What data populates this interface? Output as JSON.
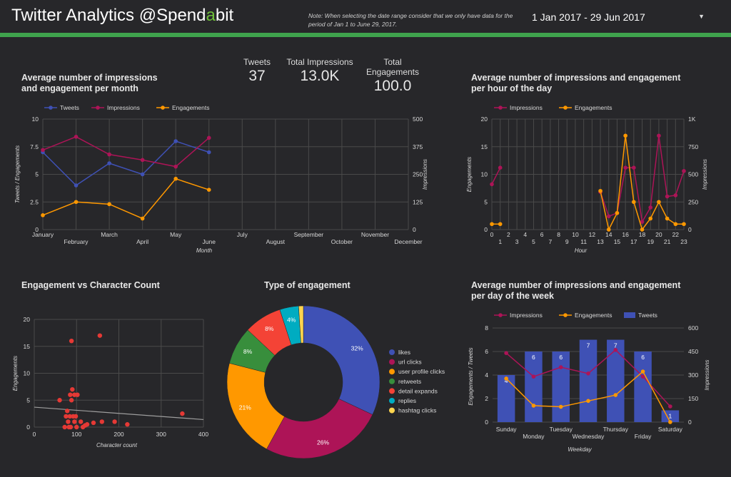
{
  "header": {
    "title_prefix": "Twitter Analytics @Spend",
    "title_highlight": "a",
    "title_suffix": "bit",
    "note": "Note: When selecting the date range consider that we only have data for the period of Jan 1 to June 29, 2017.",
    "date_range": "1 Jan 2017 - 29 Jun 2017",
    "dropdown_icon": "triangle-down",
    "accent_color": "#3fa34d"
  },
  "kpis": [
    {
      "label": "Tweets",
      "value": "37"
    },
    {
      "label": "Total Impressions",
      "value": "13.0K"
    },
    {
      "label": "Total Engagements",
      "value": "100.0"
    }
  ],
  "colors": {
    "tweets": "#3f51b5",
    "impressions": "#ad1457",
    "engagements": "#ff9800",
    "grid": "#4a4a4a",
    "axis_text": "#d8d8d8"
  },
  "chart_data": [
    {
      "id": "monthly",
      "type": "line",
      "title": "Average number of impressions and engagement per month",
      "x": [
        "January",
        "February",
        "March",
        "April",
        "May",
        "June",
        "July",
        "August",
        "September",
        "October",
        "November",
        "December"
      ],
      "series": [
        {
          "name": "Tweets",
          "axis": "left",
          "values": [
            7,
            4,
            6,
            5,
            8,
            7
          ]
        },
        {
          "name": "Impressions",
          "axis": "right",
          "values": [
            360,
            420,
            340,
            315,
            285,
            415
          ]
        },
        {
          "name": "Engagements",
          "axis": "left",
          "values": [
            1.3,
            2.5,
            2.3,
            1.0,
            4.6,
            3.6
          ]
        }
      ],
      "xlabel": "Month",
      "ylabel_left": "Tweets / Engagements",
      "ylabel_right": "Impressions",
      "ylim_left": [
        0,
        10
      ],
      "ylim_right": [
        0,
        500
      ],
      "yticks_left": [
        "0",
        "2.5",
        "5",
        "7.5",
        "10"
      ],
      "yticks_right": [
        "0",
        "125",
        "250",
        "375",
        "500"
      ],
      "legend": "top",
      "grid": true
    },
    {
      "id": "hourly",
      "type": "line",
      "title": "Average number of impressions and engagement per hour of the day",
      "x": [
        0,
        1,
        2,
        3,
        4,
        5,
        6,
        7,
        8,
        9,
        10,
        11,
        12,
        13,
        14,
        15,
        16,
        17,
        18,
        19,
        20,
        21,
        22,
        23
      ],
      "series": [
        {
          "name": "Impressions",
          "axis": "right",
          "values": [
            410,
            560,
            null,
            null,
            null,
            null,
            null,
            null,
            null,
            null,
            null,
            null,
            null,
            340,
            120,
            150,
            560,
            560,
            70,
            200,
            850,
            300,
            310,
            530
          ]
        },
        {
          "name": "Engagements",
          "axis": "left",
          "values": [
            1,
            1,
            null,
            null,
            null,
            null,
            null,
            null,
            null,
            null,
            null,
            null,
            null,
            7,
            0,
            3,
            17,
            5,
            0,
            2,
            5,
            2,
            1,
            1
          ]
        }
      ],
      "xlabel": "Hour",
      "ylabel_left": "Engagements",
      "ylabel_right": "Impressions",
      "ylim_left": [
        0,
        20
      ],
      "ylim_right": [
        0,
        1000
      ],
      "yticks_left": [
        "0",
        "5",
        "10",
        "15",
        "20"
      ],
      "yticks_right": [
        "0",
        "250",
        "500",
        "750",
        "1K"
      ],
      "legend": "top",
      "grid": true
    },
    {
      "id": "scatter",
      "type": "scatter",
      "title": "Engagement vs Character Count",
      "points": [
        [
          60,
          5
        ],
        [
          72,
          0
        ],
        [
          75,
          2
        ],
        [
          78,
          3
        ],
        [
          80,
          1
        ],
        [
          82,
          0
        ],
        [
          84,
          2
        ],
        [
          85,
          6
        ],
        [
          86,
          0
        ],
        [
          88,
          5
        ],
        [
          88,
          16
        ],
        [
          90,
          7
        ],
        [
          92,
          2
        ],
        [
          95,
          1
        ],
        [
          95,
          6
        ],
        [
          98,
          2
        ],
        [
          100,
          0
        ],
        [
          102,
          6
        ],
        [
          110,
          1
        ],
        [
          115,
          0
        ],
        [
          120,
          0.3
        ],
        [
          125,
          0.5
        ],
        [
          140,
          0.8
        ],
        [
          155,
          17
        ],
        [
          160,
          1
        ],
        [
          190,
          1
        ],
        [
          220,
          0.5
        ],
        [
          350,
          2.5
        ]
      ],
      "trendline": [
        [
          0,
          3.7
        ],
        [
          400,
          1.4
        ]
      ],
      "xlabel": "Character count",
      "ylabel": "Engagements",
      "xlim": [
        0,
        400
      ],
      "ylim": [
        0,
        20
      ],
      "xticks": [
        "0",
        "100",
        "200",
        "300",
        "400"
      ],
      "yticks": [
        "0",
        "5",
        "10",
        "15",
        "20"
      ],
      "grid": true
    },
    {
      "id": "donut",
      "type": "pie",
      "title": "Type of engagement",
      "slices": [
        {
          "label": "likes",
          "value": 32,
          "text": "32%",
          "color": "#3f51b5"
        },
        {
          "label": "url clicks",
          "value": 26,
          "text": "26%",
          "color": "#ad1457"
        },
        {
          "label": "user profile clicks",
          "value": 21,
          "text": "21%",
          "color": "#ff9800"
        },
        {
          "label": "retweets",
          "value": 8,
          "text": "8%",
          "color": "#388e3c"
        },
        {
          "label": "detail expands",
          "value": 8,
          "text": "8%",
          "color": "#f44336"
        },
        {
          "label": "replies",
          "value": 4,
          "text": "4%",
          "color": "#00acc1"
        },
        {
          "label": "hashtag clicks",
          "value": 1,
          "text": "",
          "color": "#ffd54f"
        }
      ],
      "legend": "right"
    },
    {
      "id": "weekday",
      "type": "bar",
      "title": "Average number of impressions and engagement per day of the week",
      "categories": [
        "Sunday",
        "Monday",
        "Tuesday",
        "Wednesday",
        "Thursday",
        "Friday",
        "Saturday"
      ],
      "series": [
        {
          "name": "Impressions",
          "axis": "right",
          "type": "line",
          "values": [
            440,
            290,
            350,
            310,
            460,
            290,
            100
          ]
        },
        {
          "name": "Engagements",
          "axis": "left",
          "type": "line",
          "values": [
            3.7,
            1.4,
            1.3,
            1.8,
            2.3,
            4.3,
            0
          ]
        },
        {
          "name": "Tweets",
          "axis": "left",
          "type": "bar",
          "values": [
            4,
            6,
            6,
            7,
            7,
            6,
            1
          ]
        }
      ],
      "bar_labels": [
        "4",
        "6",
        "6",
        "7",
        "7",
        "6",
        "1"
      ],
      "xlabel": "Weekday",
      "ylabel_left": "Engagements / Tweets",
      "ylabel_right": "Impressions",
      "ylim_left": [
        0,
        8
      ],
      "ylim_right": [
        0,
        600
      ],
      "yticks_left": [
        "0",
        "2",
        "4",
        "6",
        "8"
      ],
      "yticks_right": [
        "0",
        "150",
        "300",
        "450",
        "600"
      ],
      "legend": "top",
      "grid": true
    }
  ]
}
